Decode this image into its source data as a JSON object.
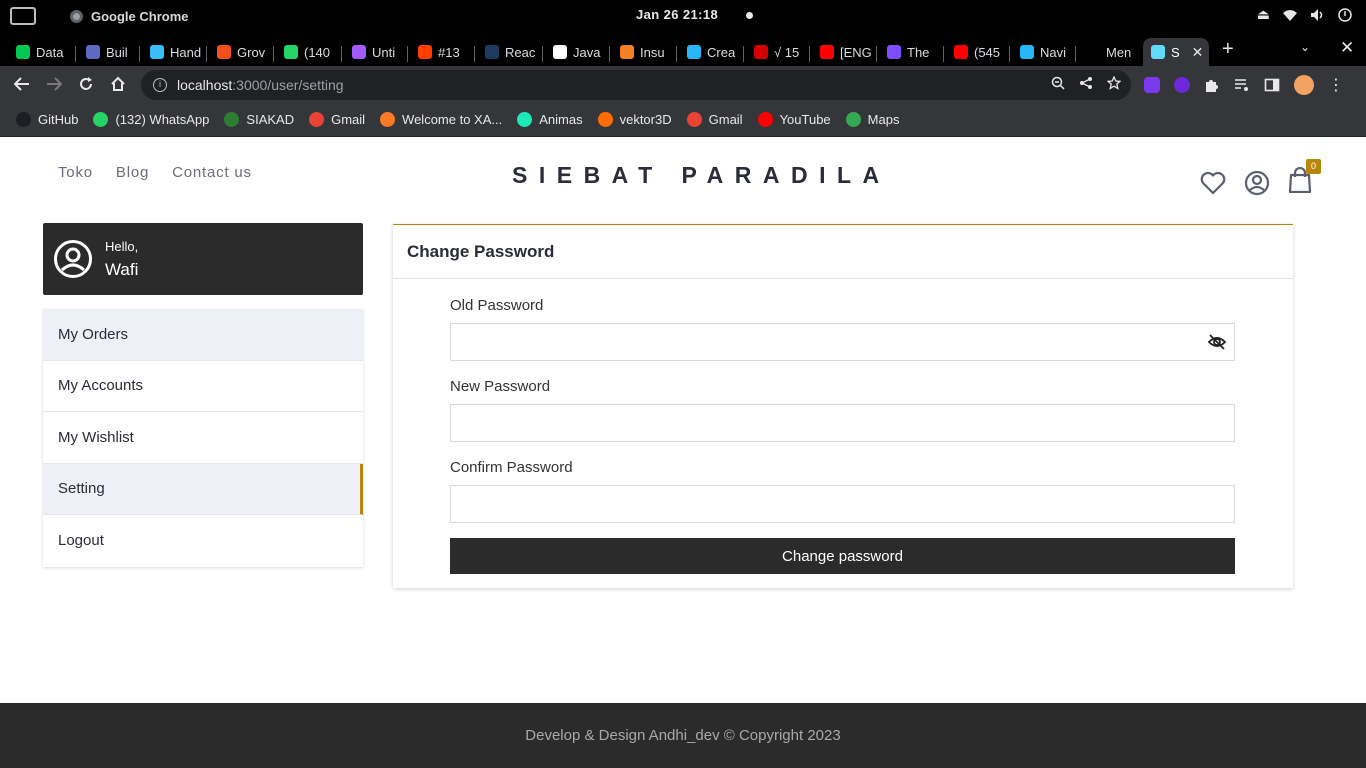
{
  "os": {
    "app_name": "Google Chrome",
    "clock": "Jan 26  21:18"
  },
  "tabs": [
    {
      "label": "Data",
      "color": "#00c853"
    },
    {
      "label": "Buil",
      "color": "#5c6bc0"
    },
    {
      "label": "Hand",
      "color": "#38bdf8"
    },
    {
      "label": "Grov",
      "color": "#f24e1e"
    },
    {
      "label": "(140",
      "color": "#25d366"
    },
    {
      "label": "Unti",
      "color": "#a259ff"
    },
    {
      "label": "#13",
      "color": "#ff3d00"
    },
    {
      "label": "Reac",
      "color": "#1e3a5f"
    },
    {
      "label": "Java",
      "color": "#ffffff"
    },
    {
      "label": "Insu",
      "color": "#f48024"
    },
    {
      "label": "Crea",
      "color": "#29b6f6"
    },
    {
      "label": "√ 15",
      "color": "#d50000"
    },
    {
      "label": "[ENG",
      "color": "#ff0000"
    },
    {
      "label": "The",
      "color": "#7c4dff"
    },
    {
      "label": "(545",
      "color": "#ff0000"
    },
    {
      "label": "Navi",
      "color": "#29b6f6"
    },
    {
      "label": "Men",
      "color": "#000000"
    },
    {
      "label": "S",
      "color": "#61dafb"
    }
  ],
  "address": {
    "host": "localhost",
    "path": ":3000/user/setting"
  },
  "bookmarks": [
    {
      "label": "GitHub",
      "color": "#1b1f23"
    },
    {
      "label": "(132) WhatsApp",
      "color": "#25d366"
    },
    {
      "label": "SIAKAD",
      "color": "#2e7d32"
    },
    {
      "label": "Gmail",
      "color": "#ea4335"
    },
    {
      "label": "Welcome to XA...",
      "color": "#fb7a24"
    },
    {
      "label": "Animas",
      "color": "#1de9b6"
    },
    {
      "label": "vektor3D",
      "color": "#ff6d00"
    },
    {
      "label": "Gmail",
      "color": "#ea4335"
    },
    {
      "label": "YouTube",
      "color": "#ff0000"
    },
    {
      "label": "Maps",
      "color": "#34a853"
    }
  ],
  "site": {
    "nav": [
      "Toko",
      "Blog",
      "Contact us"
    ],
    "brand": "SIEBAT PARADILA",
    "cart_count": "0",
    "accent": "#b8860b"
  },
  "sidebar": {
    "hello": "Hello,",
    "name": "Wafi",
    "items": [
      {
        "label": "My Orders"
      },
      {
        "label": "My Accounts"
      },
      {
        "label": "My Wishlist"
      },
      {
        "label": "Setting"
      },
      {
        "label": "Logout"
      }
    ]
  },
  "form": {
    "title": "Change Password",
    "old_label": "Old Password",
    "new_label": "New Password",
    "confirm_label": "Confirm Password",
    "old_value": "",
    "new_value": "",
    "confirm_value": "",
    "submit": "Change password"
  },
  "footer": {
    "text": "Develop & Design Andhi_dev © Copyright 2023"
  }
}
